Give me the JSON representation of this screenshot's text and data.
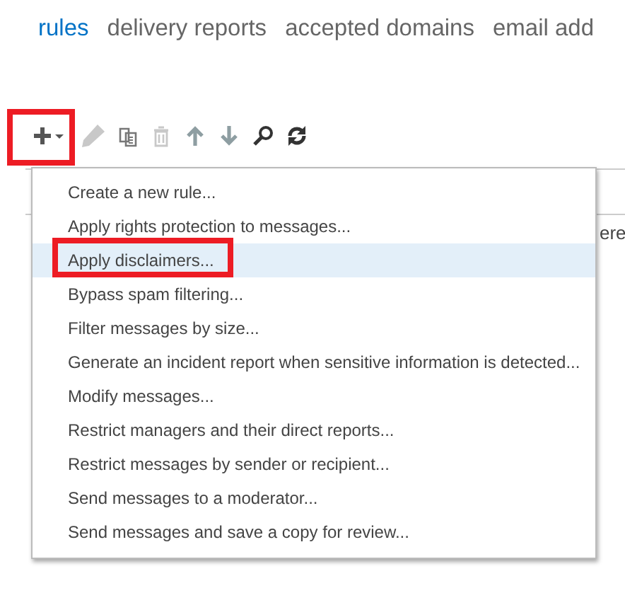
{
  "tabs": [
    {
      "label": "rules",
      "selected": true
    },
    {
      "label": "delivery reports",
      "selected": false
    },
    {
      "label": "accepted domains",
      "selected": false
    },
    {
      "label": "email add",
      "selected": false
    }
  ],
  "toolbar": [
    {
      "kind": "add",
      "disabled": false,
      "highlighted": true
    },
    {
      "kind": "edit",
      "disabled": true,
      "highlighted": false
    },
    {
      "kind": "copy",
      "disabled": false,
      "highlighted": false
    },
    {
      "kind": "delete",
      "disabled": true,
      "highlighted": false
    },
    {
      "kind": "up",
      "disabled": false,
      "highlighted": false
    },
    {
      "kind": "down",
      "disabled": false,
      "highlighted": false
    },
    {
      "kind": "search",
      "disabled": false,
      "highlighted": false
    },
    {
      "kind": "refresh",
      "disabled": false,
      "highlighted": false
    }
  ],
  "table": {
    "column_text": "ere"
  },
  "menu": {
    "items": [
      {
        "label": "Create a new rule...",
        "selected": false,
        "highlighted": false
      },
      {
        "label": "Apply rights protection to messages...",
        "selected": false,
        "highlighted": false
      },
      {
        "label": "Apply disclaimers...",
        "selected": true,
        "highlighted": true
      },
      {
        "label": "Bypass spam filtering...",
        "selected": false,
        "highlighted": false
      },
      {
        "label": "Filter messages by size...",
        "selected": false,
        "highlighted": false
      },
      {
        "label": "Generate an incident report when sensitive information is detected...",
        "selected": false,
        "highlighted": false
      },
      {
        "label": "Modify messages...",
        "selected": false,
        "highlighted": false
      },
      {
        "label": "Restrict managers and their direct reports...",
        "selected": false,
        "highlighted": false
      },
      {
        "label": "Restrict messages by sender or recipient...",
        "selected": false,
        "highlighted": false
      },
      {
        "label": "Send messages to a moderator...",
        "selected": false,
        "highlighted": false
      },
      {
        "label": "Send messages and save a copy for review...",
        "selected": false,
        "highlighted": false
      }
    ]
  }
}
